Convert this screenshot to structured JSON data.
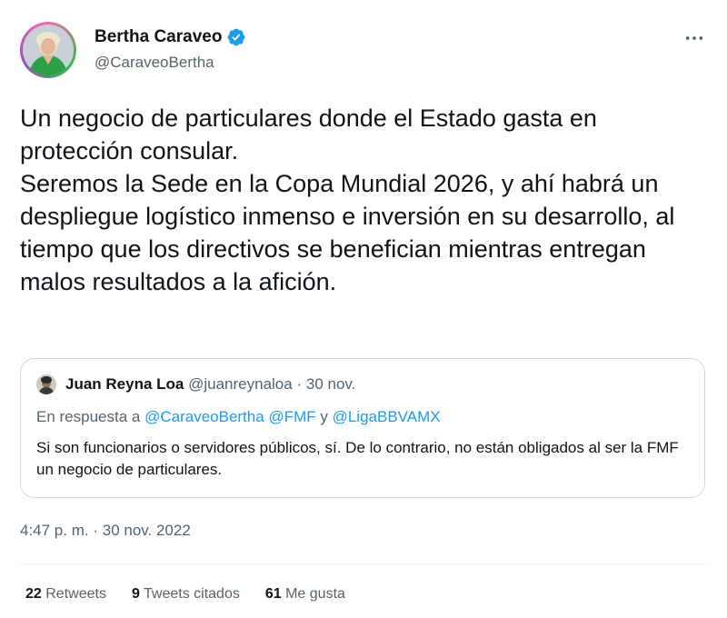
{
  "author": {
    "display_name": "Bertha Caraveo",
    "handle": "@CaraveoBertha",
    "verified": true
  },
  "tweet": {
    "text_lines": [
      "Un negocio de particulares donde el Estado gasta en protección consular.",
      "Seremos la Sede en la Copa Mundial 2026, y ahí habrá un despliegue logístico inmenso e inversión en su desarrollo, al tiempo que los directivos se benefician mientras entregan malos resultados a la afición."
    ]
  },
  "quoted_tweet": {
    "display_name": "Juan Reyna Loa",
    "handle": "@juanreynaloa",
    "separator": "·",
    "date": "30 nov.",
    "reply_prefix": "En respuesta a",
    "reply_mentions": [
      "@CaraveoBertha",
      "@FMF",
      "@LigaBBVAMX"
    ],
    "reply_connector": "y",
    "text": "Si son funcionarios o servidores públicos, sí. De lo contrario, no están obligados al ser la FMF un negocio de particulares."
  },
  "timestamp": {
    "time": "4:47 p. m.",
    "separator": "·",
    "date": "30 nov. 2022"
  },
  "stats": {
    "retweets": {
      "count": "22",
      "label": "Retweets"
    },
    "quotes": {
      "count": "9",
      "label": "Tweets citados"
    },
    "likes": {
      "count": "61",
      "label": "Me gusta"
    }
  },
  "icons": {
    "verified": "verified-badge-icon",
    "more": "more-options-icon"
  },
  "colors": {
    "verified_blue": "#1d9bf0",
    "link_blue": "#1d9bf0",
    "secondary_text": "#536471",
    "border": "#cfd9de"
  }
}
